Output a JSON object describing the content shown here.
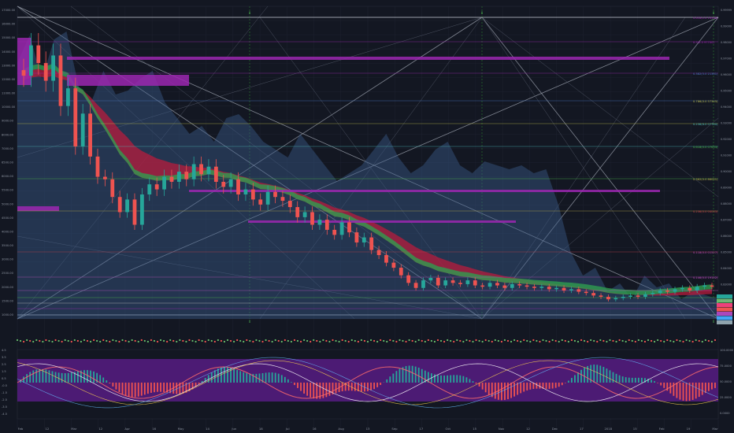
{
  "chart_data": [
    {
      "type": "candlestick",
      "role": "price-pane",
      "title": "",
      "x_ticks": [
        "Feb",
        "12",
        "Mar",
        "12",
        "Apr",
        "16",
        "May",
        "14",
        "Jun",
        "18",
        "Jul",
        "16",
        "Aug",
        "13",
        "Sep",
        "17",
        "Oct",
        "15",
        "Nov",
        "12",
        "Dec",
        "17",
        "2018",
        "15",
        "Feb",
        "19",
        "Mar"
      ],
      "y_ticks": [
        "17000.00",
        "16000.00",
        "15000.00",
        "14000.00",
        "13000.00",
        "12000.00",
        "11000.00",
        "10000.00",
        "9000.00",
        "8000.00",
        "7000.00",
        "6500.00",
        "6000.00",
        "5500.00",
        "5000.00",
        "4500.00",
        "4000.00",
        "3500.00",
        "3000.00",
        "2500.00",
        "2000.00",
        "1500.00",
        "1000.00"
      ],
      "right_labels": [
        "0.618(2.0 16560)",
        "0.5(2.3 97700)",
        "0.382(5.0 21361)",
        "0.786(0.0 57345)",
        "0.236(6.0 07780)",
        "0.618(0.0 07633)",
        "0.382(0.0 86051)",
        "0.236(0.0 04035)",
        "0.118(0.0 01527)",
        "0.146(0.0 19152)"
      ],
      "top_marks": [
        "0",
        "0",
        "0"
      ],
      "bottom_marks": [
        "0",
        "0"
      ],
      "close_approx": [
        11000,
        12200,
        11500,
        10800,
        11800,
        9800,
        10500,
        8200,
        9500,
        7800,
        7000,
        6900,
        6200,
        5600,
        6100,
        5100,
        6300,
        6700,
        6500,
        7000,
        6800,
        7200,
        6900,
        7500,
        7100,
        7400,
        6800,
        6600,
        6900,
        6300,
        6500,
        6100,
        5900,
        6400,
        6200,
        6050,
        5800,
        5400,
        5600,
        5100,
        5300,
        4900,
        4700,
        5200,
        4800,
        4400,
        4600,
        4100,
        3900,
        3600,
        3400,
        3100,
        2800,
        2600,
        2900,
        3000,
        2700,
        2900,
        2800,
        2750,
        2900,
        2700,
        2650,
        2800,
        2700,
        2600,
        2750,
        2700,
        2650,
        2600,
        2650,
        2550,
        2600,
        2500,
        2550,
        2450,
        2400,
        2300,
        2250,
        2150,
        2200,
        2250,
        2300,
        2250,
        2350,
        2400,
        2500,
        2450,
        2550,
        2600,
        2500,
        2650,
        2700,
        2650
      ]
    },
    {
      "type": "line",
      "role": "oscillator-pane",
      "y_ticks": [
        "4.5",
        "3.5",
        "2.5",
        "1.5",
        "0.5",
        "-0.5",
        "-1.5",
        "-2.5",
        "-3.5",
        "-4.5"
      ],
      "right_ticks": [
        "100.0000",
        "75.0000",
        "50.0000",
        "25.0000",
        "0.0000"
      ],
      "band": [
        -2.5,
        2.5
      ]
    }
  ],
  "colors": {
    "background": "#131722",
    "bull": "#26a69a",
    "bear": "#ef5350",
    "accent": "#9c27b0",
    "ribbon_green": "#2e9e4f",
    "ribbon_red": "#b71c3c",
    "cloud": "#3a5a8a"
  }
}
